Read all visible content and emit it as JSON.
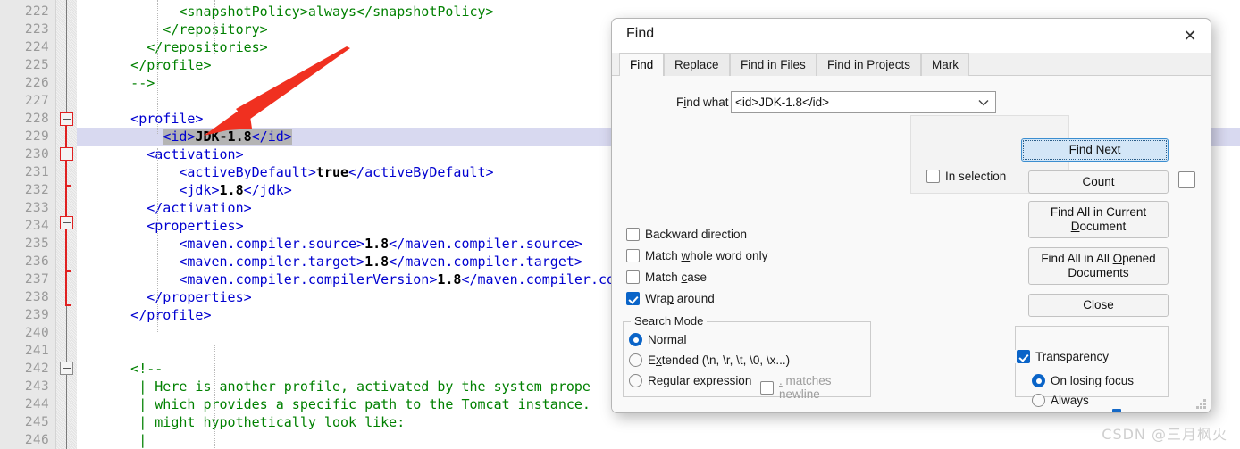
{
  "editor": {
    "first_line_number": 222,
    "lines": [
      {
        "n": 222,
        "indent": 0,
        "segments": [
          {
            "t": "            <snapshotPolicy>always</snapshotPolicy>",
            "c": "cmt"
          }
        ]
      },
      {
        "n": 223,
        "indent": 0,
        "segments": [
          {
            "t": "          </repository>",
            "c": "cmt"
          }
        ]
      },
      {
        "n": 224,
        "indent": 0,
        "segments": [
          {
            "t": "        </repositories>",
            "c": "cmt"
          }
        ]
      },
      {
        "n": 225,
        "indent": 0,
        "segments": [
          {
            "t": "      </profile>",
            "c": "cmt"
          }
        ]
      },
      {
        "n": 226,
        "indent": 0,
        "segments": [
          {
            "t": "      -->",
            "c": "cmt"
          }
        ]
      },
      {
        "n": 227,
        "indent": 0,
        "segments": [
          {
            "t": "",
            "c": "txt"
          }
        ]
      },
      {
        "n": 228,
        "indent": 0,
        "segments": [
          {
            "t": "      <profile>",
            "c": "tag"
          }
        ]
      },
      {
        "n": 229,
        "indent": 0,
        "highlight": true,
        "segments": [
          {
            "t": "          ",
            "c": "txt"
          },
          {
            "t": "<id>",
            "c": "tag sel"
          },
          {
            "t": "JDK-1.8",
            "c": "txt sel"
          },
          {
            "t": "</id>",
            "c": "tag sel"
          }
        ]
      },
      {
        "n": 230,
        "indent": 0,
        "segments": [
          {
            "t": "        <activation>",
            "c": "tag"
          }
        ]
      },
      {
        "n": 231,
        "indent": 0,
        "segments": [
          {
            "t": "            <activeByDefault>",
            "c": "tag"
          },
          {
            "t": "true",
            "c": "txt"
          },
          {
            "t": "</activeByDefault>",
            "c": "tag"
          }
        ]
      },
      {
        "n": 232,
        "indent": 0,
        "segments": [
          {
            "t": "            <jdk>",
            "c": "tag"
          },
          {
            "t": "1.8",
            "c": "txt"
          },
          {
            "t": "</jdk>",
            "c": "tag"
          }
        ]
      },
      {
        "n": 233,
        "indent": 0,
        "segments": [
          {
            "t": "        </activation>",
            "c": "tag"
          }
        ]
      },
      {
        "n": 234,
        "indent": 0,
        "segments": [
          {
            "t": "        <properties>",
            "c": "tag"
          }
        ]
      },
      {
        "n": 235,
        "indent": 0,
        "segments": [
          {
            "t": "            <maven.compiler.source>",
            "c": "tag"
          },
          {
            "t": "1.8",
            "c": "txt"
          },
          {
            "t": "</maven.compiler.source>",
            "c": "tag"
          }
        ]
      },
      {
        "n": 236,
        "indent": 0,
        "segments": [
          {
            "t": "            <maven.compiler.target>",
            "c": "tag"
          },
          {
            "t": "1.8",
            "c": "txt"
          },
          {
            "t": "</maven.compiler.target>",
            "c": "tag"
          }
        ]
      },
      {
        "n": 237,
        "indent": 0,
        "segments": [
          {
            "t": "            <maven.compiler.compilerVersion>",
            "c": "tag"
          },
          {
            "t": "1.8",
            "c": "txt"
          },
          {
            "t": "</maven.compiler.compilerVersion>",
            "c": "tag"
          }
        ]
      },
      {
        "n": 238,
        "indent": 0,
        "segments": [
          {
            "t": "        </properties>",
            "c": "tag"
          }
        ]
      },
      {
        "n": 239,
        "indent": 0,
        "segments": [
          {
            "t": "      </profile>",
            "c": "tag"
          }
        ]
      },
      {
        "n": 240,
        "indent": 0,
        "segments": [
          {
            "t": "",
            "c": "txt"
          }
        ]
      },
      {
        "n": 241,
        "indent": 0,
        "segments": [
          {
            "t": "",
            "c": "txt"
          }
        ]
      },
      {
        "n": 242,
        "indent": 0,
        "segments": [
          {
            "t": "      <!--",
            "c": "cmt"
          }
        ]
      },
      {
        "n": 243,
        "indent": 0,
        "segments": [
          {
            "t": "       | Here is another profile, activated by the system prope",
            "c": "cmt"
          }
        ]
      },
      {
        "n": 244,
        "indent": 0,
        "segments": [
          {
            "t": "       | which provides a specific path to the Tomcat instance.",
            "c": "cmt"
          }
        ]
      },
      {
        "n": 245,
        "indent": 0,
        "segments": [
          {
            "t": "       | might hypothetically look like:",
            "c": "cmt"
          }
        ]
      },
      {
        "n": 246,
        "indent": 0,
        "segments": [
          {
            "t": "       |",
            "c": "cmt"
          }
        ]
      }
    ],
    "colors": {
      "tag": "#0000d0",
      "text": "#000000",
      "comment": "#008000",
      "selection": "#b4b4b4",
      "current_line": "#d8d9f0",
      "gutter_bg": "#e8e8e8",
      "gutter_fg": "#9a9a9a",
      "fold_marker": "#e02020"
    },
    "annotation": {
      "name": "red-arrow",
      "color": "#f03020"
    }
  },
  "dialog": {
    "title": "Find",
    "close_label": "✕",
    "tabs": [
      {
        "label": "Find",
        "active": true
      },
      {
        "label": "Replace",
        "active": false
      },
      {
        "label": "Find in Files",
        "active": false
      },
      {
        "label": "Find in Projects",
        "active": false
      },
      {
        "label": "Mark",
        "active": false
      }
    ],
    "find_what": {
      "label_pre": "F",
      "label_accel": "i",
      "label_post": "nd what :",
      "value": "<id>JDK-1.8</id>",
      "placeholder": "",
      "dropdown_icon": "chevron-down-icon"
    },
    "buttons": {
      "find_next": "Find Next",
      "count_pre": "Coun",
      "count_accel": "t",
      "count_post": "",
      "find_all_current_l1": "Find All in Current",
      "find_all_current_accel": "D",
      "find_all_current_l2_post": "ocument",
      "find_all_opened_l1_pre": "Find All in All ",
      "find_all_opened_accel": "O",
      "find_all_opened_l1_post": "pened",
      "find_all_opened_l2": "Documents",
      "close": "Close"
    },
    "in_selection": {
      "label": "In selection",
      "checked": false
    },
    "options": [
      {
        "name": "backward-direction",
        "pre": "Backward direction",
        "accel": "",
        "post": "",
        "checked": false
      },
      {
        "name": "match-whole-word-only",
        "pre": "Match ",
        "accel": "w",
        "post": "hole word only",
        "checked": false
      },
      {
        "name": "match-case",
        "pre": "Match ",
        "accel": "c",
        "post": "ase",
        "checked": false
      },
      {
        "name": "wrap-around",
        "pre": "Wra",
        "accel": "p",
        "post": " around",
        "checked": true
      }
    ],
    "search_mode": {
      "legend": "Search Mode",
      "options": [
        {
          "name": "normal",
          "pre": "",
          "accel": "N",
          "post": "ormal",
          "selected": true
        },
        {
          "name": "extended",
          "pre": "E",
          "accel": "x",
          "post": "tended (\\n, \\r, \\t, \\0, \\x...)",
          "selected": false
        },
        {
          "name": "regular-expression",
          "pre": "Re",
          "accel": "g",
          "post": "ular expression",
          "selected": false
        }
      ],
      "dot_matches_newline": {
        "prefix": ".",
        "label": " matches newline",
        "checked": false,
        "disabled": true
      }
    },
    "transparency": {
      "label": "Transparency",
      "checked": true,
      "options": [
        {
          "name": "on-losing-focus",
          "label": "On losing focus",
          "selected": true
        },
        {
          "name": "always",
          "label": "Always",
          "selected": false
        }
      ],
      "slider_percent": 66
    }
  },
  "watermark": {
    "text": "CSDN @三月枫火"
  }
}
